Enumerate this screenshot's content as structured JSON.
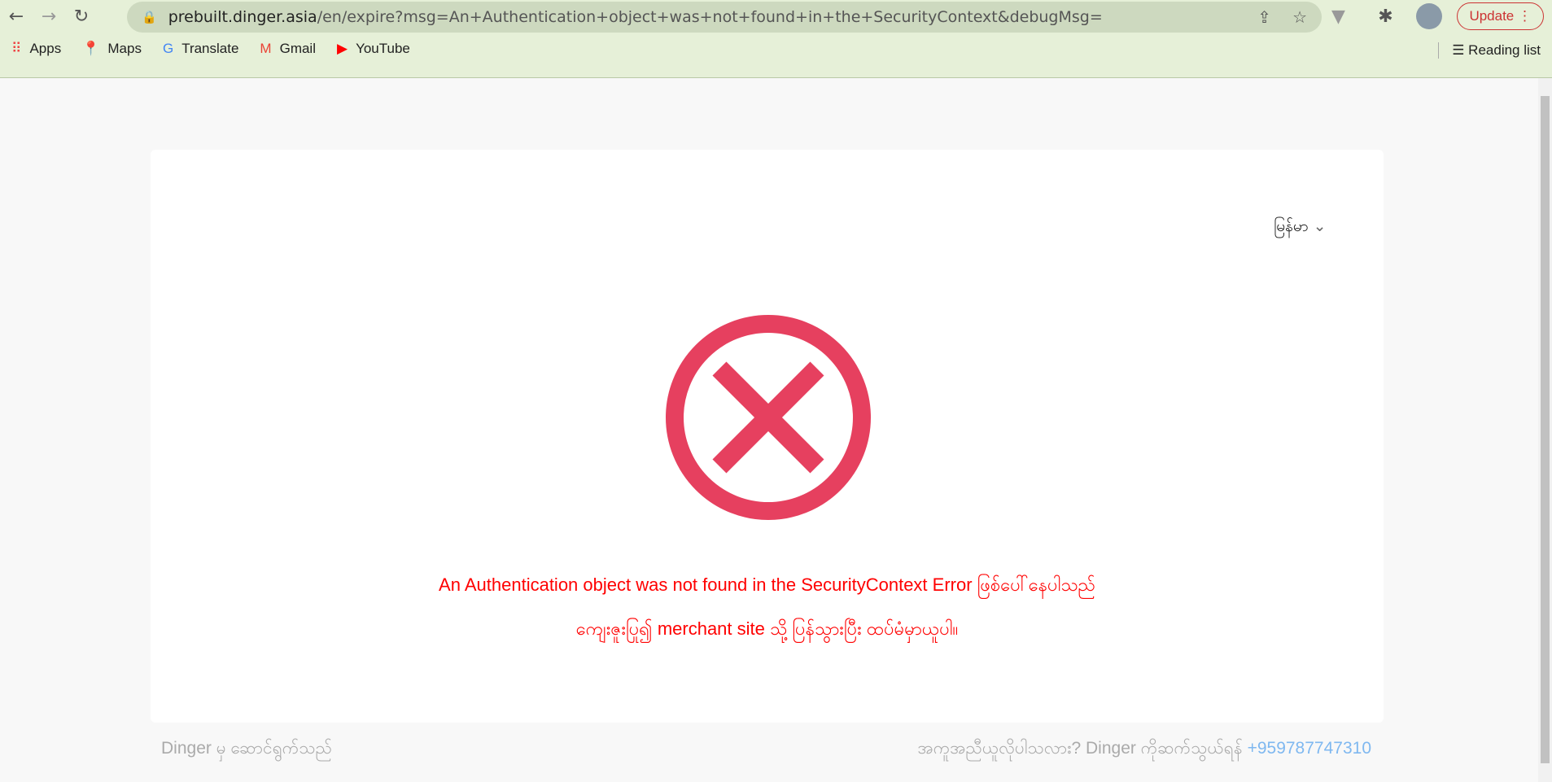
{
  "browser": {
    "url_host": "prebuilt.dinger.asia",
    "url_path": "/en/expire?msg=An+Authentication+object+was+not+found+in+the+SecurityContext&debugMsg=",
    "update_label": "Update",
    "bookmarks": [
      {
        "label": "Apps",
        "icon": "apps-grid-icon"
      },
      {
        "label": "Maps",
        "icon": "maps-pin-icon"
      },
      {
        "label": "Translate",
        "icon": "translate-icon"
      },
      {
        "label": "Gmail",
        "icon": "gmail-icon"
      },
      {
        "label": "YouTube",
        "icon": "youtube-icon"
      }
    ],
    "reading_list": "Reading list"
  },
  "page": {
    "language": "မြန်မာ",
    "error_line1": "An Authentication object was not found in the SecurityContext Error ဖြစ်ပေါ်နေပါသည်",
    "error_line2": "ကျေးဇူးပြု၍ merchant site သို့ ပြန်သွားပြီး ထပ်မံမှာယူပါ။",
    "error_color": "#e6405f",
    "footer_left": "Dinger မှ ဆောင်ရွက်သည်",
    "footer_help": "အကူအညီယူလိုပါသလား? Dinger ကိုဆက်သွယ်ရန်",
    "footer_phone": "+959787747310"
  }
}
